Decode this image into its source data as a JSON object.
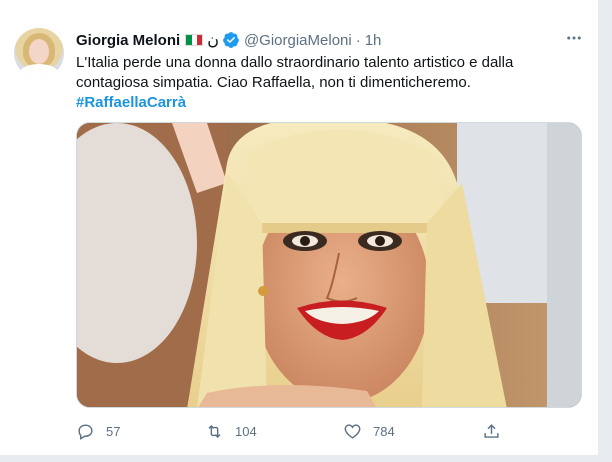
{
  "tweet": {
    "author_name": "Giorgia Meloni",
    "flag_icon": "italy-flag",
    "arabic_char": "ن",
    "handle": "@GiorgiaMeloni",
    "separator": "·",
    "time": "1h",
    "text": "L'Italia perde una donna dallo straordinario talento artistico e dalla contagiosa simpatia. Ciao Raffaella, non ti dimenticheremo.",
    "hashtag": "#RaffaellaCarrà",
    "colors": {
      "link": "#1b95e0",
      "verified": "#1d9bf0",
      "muted": "#5b7083"
    }
  },
  "actions": {
    "reply_count": "57",
    "retweet_count": "104",
    "like_count": "784"
  }
}
